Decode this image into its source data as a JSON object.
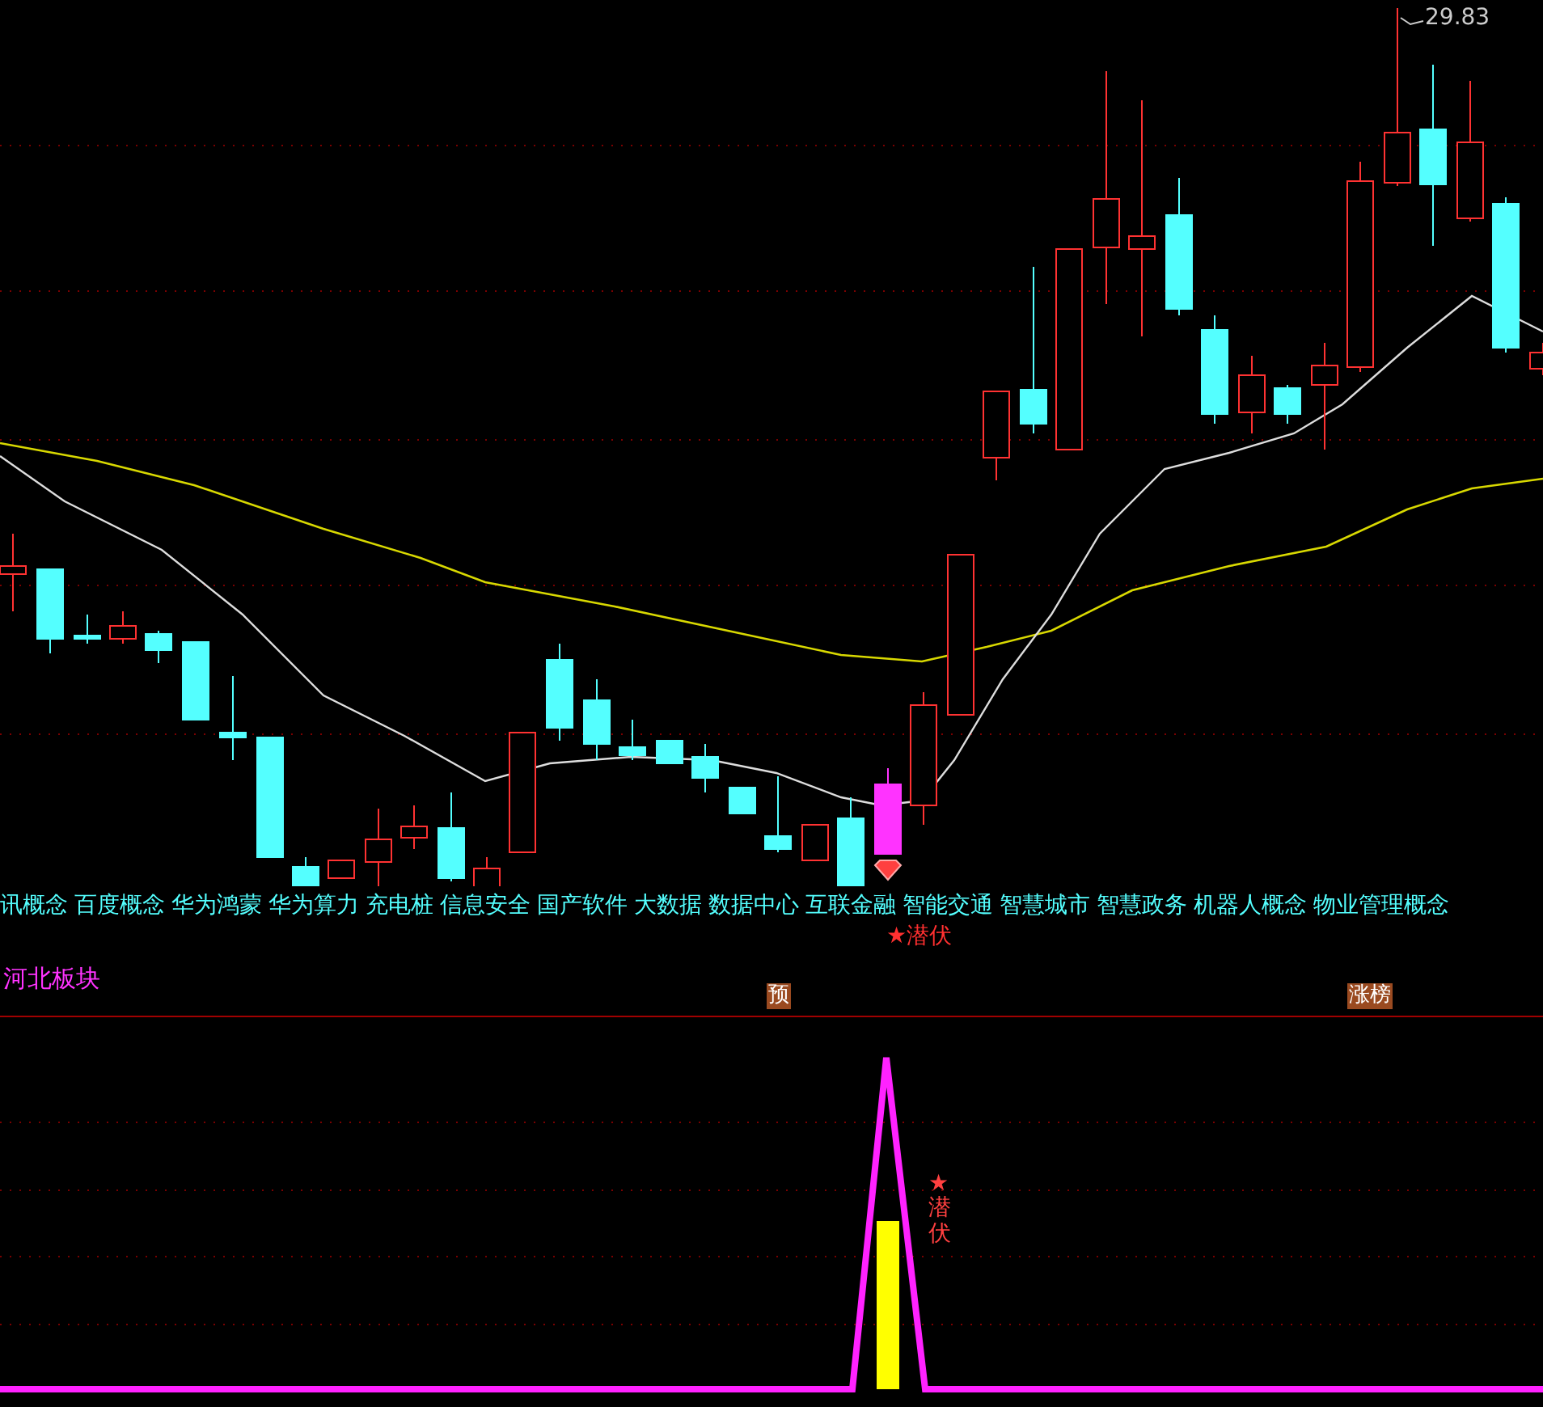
{
  "price_label": "29.83",
  "concept_tags": [
    "讯概念",
    "百度概念",
    "华为鸿蒙",
    "华为算力",
    "充电桩",
    "信息安全",
    "国产软件",
    "大数据",
    "数据中心",
    "互联金融",
    "智能交通",
    "智慧城市",
    "智慧政务",
    "机器人概念",
    "物业管理概念"
  ],
  "signal_label": "★潜伏",
  "sector": "河北板块",
  "badges": [
    {
      "label": "预"
    },
    {
      "label": "涨榜"
    }
  ],
  "indicator_label": "★潜伏"
}
